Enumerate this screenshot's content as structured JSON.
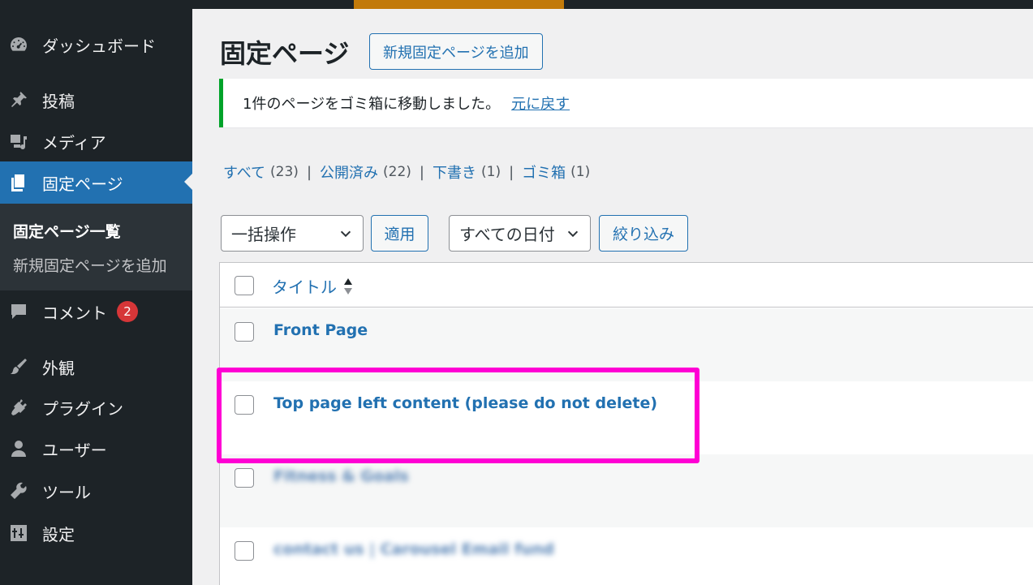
{
  "sidebar": {
    "items": [
      {
        "label": "ダッシュボード",
        "icon": "dashboard-icon"
      },
      {
        "label": "投稿",
        "icon": "pin-icon"
      },
      {
        "label": "メディア",
        "icon": "media-icon"
      },
      {
        "label": "固定ページ",
        "icon": "pages-icon"
      },
      {
        "label": "コメント",
        "icon": "comment-icon",
        "badge": "2"
      },
      {
        "label": "外観",
        "icon": "appearance-brush-icon"
      },
      {
        "label": "プラグイン",
        "icon": "plugin-icon"
      },
      {
        "label": "ユーザー",
        "icon": "user-icon"
      },
      {
        "label": "ツール",
        "icon": "wrench-icon"
      },
      {
        "label": "設定",
        "icon": "settings-icon"
      }
    ],
    "submenu": [
      "固定ページ一覧",
      "新規固定ページを追加"
    ]
  },
  "header": {
    "title": "固定ページ",
    "add_new_label": "新規固定ページを追加"
  },
  "notice": {
    "message": "1件のページをゴミ箱に移動しました。",
    "undo_label": "元に戻す"
  },
  "filters": {
    "all": {
      "label": "すべて",
      "count": "(23)"
    },
    "published": {
      "label": "公開済み",
      "count": "(22)"
    },
    "draft": {
      "label": "下書き",
      "count": "(1)"
    },
    "trash": {
      "label": "ゴミ箱",
      "count": "(1)"
    },
    "separator": "|"
  },
  "bulk": {
    "action_select": "一括操作",
    "apply_label": "適用",
    "date_select": "すべての日付",
    "filter_label": "絞り込み"
  },
  "table": {
    "column_title": "タイトル",
    "rows": [
      {
        "title": "Front Page"
      },
      {
        "title": "Top page left content (please do not delete)"
      },
      {
        "title": "Fitness & Goals"
      },
      {
        "title": "contact us | Carousel Email fund"
      }
    ]
  },
  "colors": {
    "accent": "#2271b1",
    "sidebar": "#1d2327",
    "notice_success": "#00a32a",
    "highlight": "#ff00d4",
    "badge": "#d63638"
  }
}
